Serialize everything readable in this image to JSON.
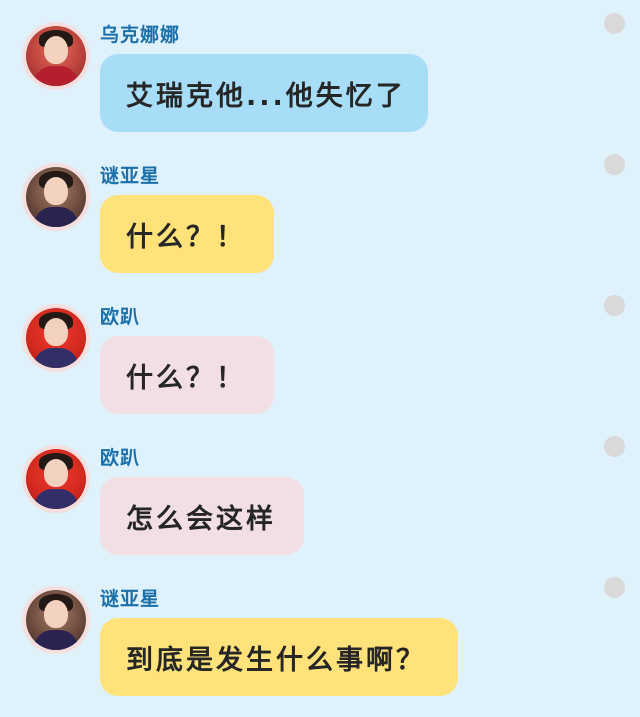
{
  "messages": [
    {
      "sender": "乌克娜娜",
      "text": "艾瑞克他...他失忆了",
      "bubble_color": "#a7ddf6",
      "avatar_theme": "red"
    },
    {
      "sender": "谜亚星",
      "text": "什么？！",
      "bubble_color": "#ffe37a",
      "avatar_theme": "brown"
    },
    {
      "sender": "欧趴",
      "text": "什么？！",
      "bubble_color": "#f2dfe3",
      "avatar_theme": "red"
    },
    {
      "sender": "欧趴",
      "text": "怎么会这样",
      "bubble_color": "#f2dfe3",
      "avatar_theme": "red"
    },
    {
      "sender": "谜亚星",
      "text": "到底是发生什么事啊？",
      "bubble_color": "#ffe37a",
      "avatar_theme": "brown"
    }
  ],
  "colors": {
    "background": "#dff1fb",
    "name_text": "#1b70a9",
    "status_dot": "#d9d9d9"
  }
}
